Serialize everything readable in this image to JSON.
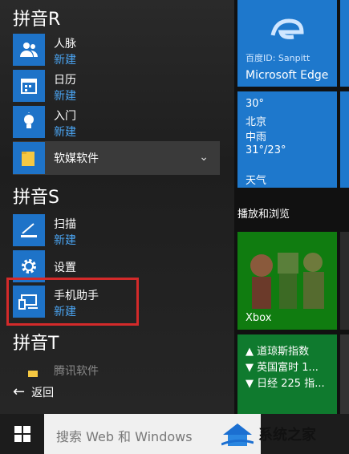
{
  "app_list": {
    "sections": [
      {
        "letter": "拼音R"
      },
      {
        "letter": "拼音S"
      },
      {
        "letter": "拼音T"
      }
    ],
    "apps": [
      {
        "name": "人脉",
        "tag": "新建",
        "icon": "people-icon"
      },
      {
        "name": "日历",
        "tag": "新建",
        "icon": "calendar-icon"
      },
      {
        "name": "入门",
        "tag": "新建",
        "icon": "lightbulb-icon"
      },
      {
        "name": "扫描",
        "tag": "新建",
        "icon": "scanner-icon"
      },
      {
        "name": "设置",
        "icon": "gear-icon"
      },
      {
        "name": "手机助手",
        "tag": "新建",
        "icon": "phone-companion-icon"
      },
      {
        "name": "腾讯软件",
        "icon": "folder-icon"
      }
    ],
    "folder": {
      "name": "软媒软件",
      "icon": "folder-icon"
    },
    "back_label": "返回"
  },
  "tiles": {
    "edge": {
      "label": "Microsoft Edge",
      "overlay": "百度ID: Sanpitt"
    },
    "weather": {
      "temp": "30°",
      "city": "北京",
      "condition": "中雨",
      "range": "31°/23°",
      "label": "天气"
    },
    "group_label": "播放和浏览",
    "xbox": {
      "label": "Xbox"
    },
    "money": {
      "lines": [
        "▲ 道琼斯指数",
        "▼ 英国富时 1...",
        "▼ 日经 225 指..."
      ]
    }
  },
  "taskbar": {
    "search_placeholder": "搜索 Web 和 Windows",
    "watermark": "系统之家"
  },
  "colors": {
    "accent": "#1e73c8",
    "highlight": "#d32a2a",
    "xbox": "#107c10"
  }
}
